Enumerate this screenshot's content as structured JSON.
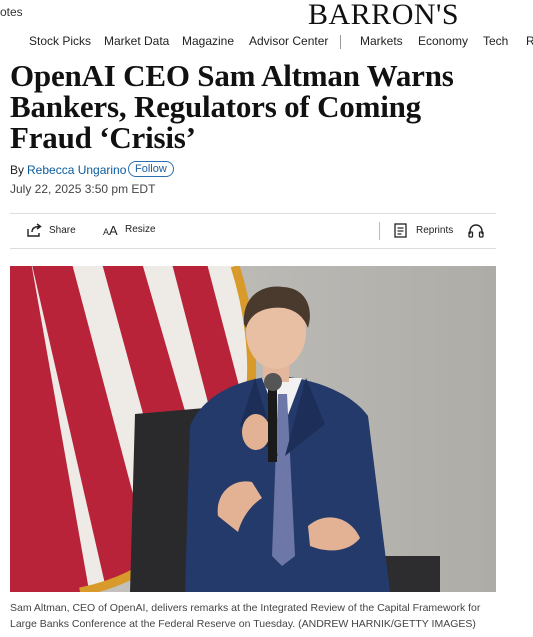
{
  "header": {
    "quotes_text": "otes",
    "logo_text": "BARRON'S"
  },
  "nav": {
    "items": [
      {
        "label": "Stock Picks"
      },
      {
        "label": "Market Data"
      },
      {
        "label": "Magazine"
      },
      {
        "label": "Advisor Center"
      },
      {
        "label": "Markets"
      },
      {
        "label": "Economy"
      },
      {
        "label": "Tech"
      },
      {
        "label": "R"
      }
    ]
  },
  "article": {
    "headline": "OpenAI CEO Sam Altman Warns Bankers, Regulators of Coming Fraud ‘Crisis’",
    "by_label": "By",
    "author": "Rebecca Ungarino",
    "follow_label": "Follow",
    "date": "July 22, 2025 3:50 pm EDT"
  },
  "toolbar": {
    "share_label": "Share",
    "resize_label": "Resize",
    "reprints_label": "Reprints",
    "share_icon": "share-icon",
    "resize_icon": "text-resize-icon",
    "reprints_icon": "document-icon",
    "audio_icon": "headphones-icon"
  },
  "photo": {
    "caption": "Sam Altman, CEO of OpenAI, delivers remarks at the Integrated Review of the Capital Framework for Large Banks Conference at the Federal Reserve on Tuesday. (ANDREW HARNIK/GETTY IMAGES)"
  },
  "colors": {
    "link": "#0a5a9c",
    "flag_red": "#b8233a",
    "flag_gold": "#d89a2a",
    "suit": "#243a6b"
  }
}
